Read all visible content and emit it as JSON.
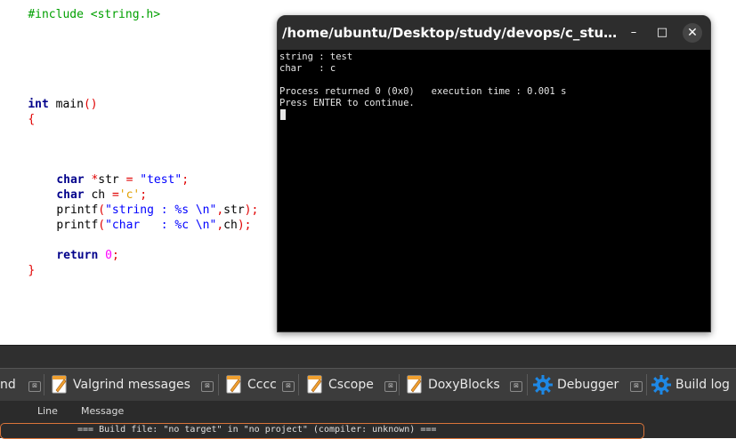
{
  "editor": {
    "lines": {
      "l0": "#include <string.h>",
      "main_kw": "int",
      "main_name": " main",
      "main_parens": "()",
      "open_brace": "{",
      "l_str_kw": "char",
      "l_str_rest_a": " *",
      "l_str_id": "str",
      "l_str_eq": " = ",
      "l_str_val": "\"test\"",
      "l_str_semi": ";",
      "l_ch_kw": "char",
      "l_ch_id": " ch ",
      "l_ch_eq": "=",
      "l_ch_val": "'c'",
      "l_ch_semi": ";",
      "l_p1_fn": "printf",
      "l_p1_open": "(",
      "l_p1_str": "\"string : %s \\n\"",
      "l_p1_comma": ",",
      "l_p1_arg": "str",
      "l_p1_close": ");",
      "l_p2_fn": "printf",
      "l_p2_open": "(",
      "l_p2_str": "\"char   : %c \\n\"",
      "l_p2_comma": ",",
      "l_p2_arg": "ch",
      "l_p2_close": ");",
      "l_ret_kw": "return",
      "l_ret_val": " 0",
      "l_ret_semi": ";",
      "close_brace": "}"
    }
  },
  "terminal": {
    "title": "/home/ubuntu/Desktop/study/devops/c_study/Gira...",
    "minimize_label": "–",
    "maximize_label": "□",
    "close_label": "✕",
    "lines": [
      "string : test",
      "char   : c",
      "",
      "Process returned 0 (0x0)   execution time : 0.001 s",
      "Press ENTER to continue."
    ]
  },
  "panel": {
    "tabs": [
      {
        "label": "nd",
        "icon": "none"
      },
      {
        "label": "Valgrind messages",
        "icon": "note-icon"
      },
      {
        "label": "Cccc",
        "icon": "note-icon"
      },
      {
        "label": "Cscope",
        "icon": "note-icon"
      },
      {
        "label": "DoxyBlocks",
        "icon": "note-icon"
      },
      {
        "label": "Debugger",
        "icon": "gear-icon"
      },
      {
        "label": "Build log",
        "icon": "gear-icon"
      }
    ],
    "columns": {
      "line": "Line",
      "message": "Message"
    },
    "log_message": "=== Build file: \"no target\" in \"no project\" (compiler: unknown) ===",
    "colors": {
      "accent": "#d9743a",
      "gear": "#1e88e5",
      "note": "#f0a030"
    }
  }
}
